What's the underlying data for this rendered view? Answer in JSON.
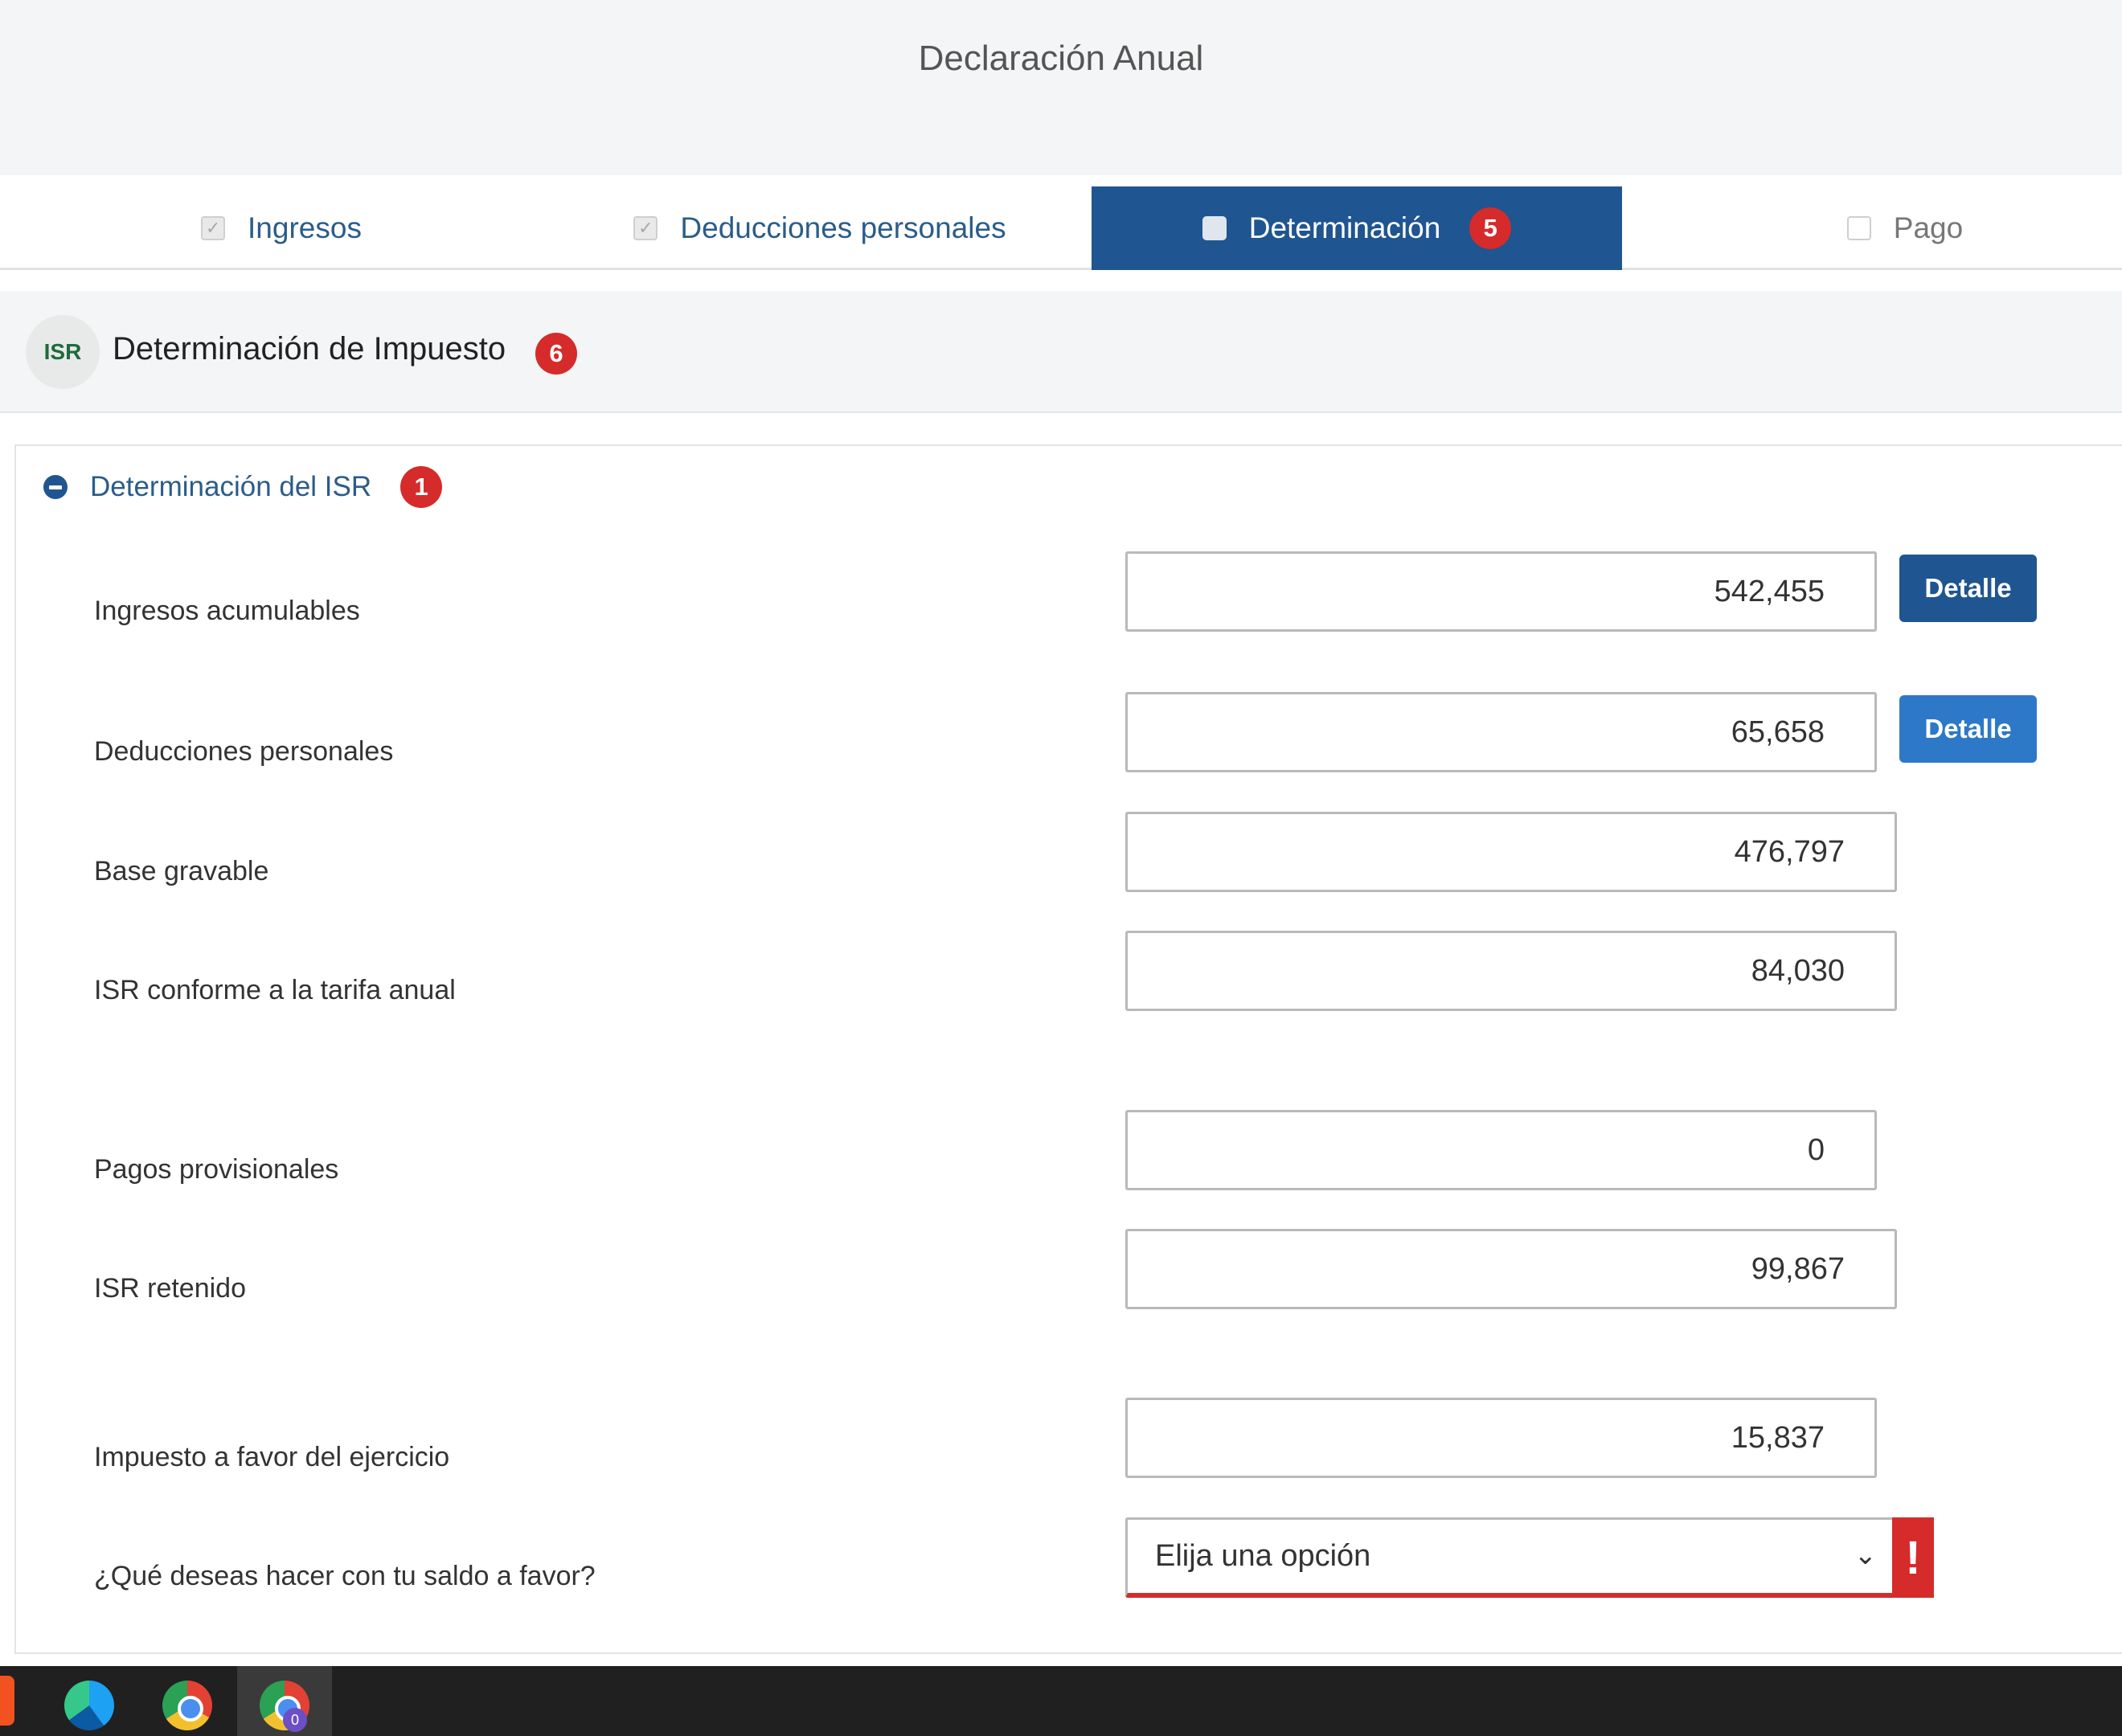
{
  "header": {
    "title": "Declaración Anual"
  },
  "tabs": [
    {
      "label": "Ingresos",
      "checked": true
    },
    {
      "label": "Deducciones personales",
      "checked": true
    },
    {
      "label": "Determinación",
      "badge": "5",
      "active": true
    },
    {
      "label": "Pago",
      "checked": false
    }
  ],
  "section": {
    "icon_text": "ISR",
    "title": "Determinación de Impuesto",
    "badge": "6"
  },
  "subsection": {
    "title": "Determinación del ISR",
    "badge": "1"
  },
  "rows": [
    {
      "label": "Ingresos acumulables",
      "value": "542,455",
      "button": "Detalle"
    },
    {
      "label": "Deducciones personales",
      "value": "65,658",
      "button": "Detalle"
    },
    {
      "label": "Base gravable",
      "value": "476,797"
    },
    {
      "label": "ISR conforme a la tarifa anual",
      "value": "84,030"
    },
    {
      "label": "Pagos provisionales",
      "value": "0"
    },
    {
      "label": "ISR retenido",
      "value": "99,867"
    },
    {
      "label": "Impuesto a favor del ejercicio",
      "value": "15,837"
    }
  ],
  "saldo_question": {
    "label": "¿Qué deseas hacer con tu saldo a favor?",
    "selected": "Elija una opción",
    "error_mark": "!"
  },
  "taskbar": {
    "chrome_profile_badge": "0"
  },
  "colors": {
    "primary": "#1f5590",
    "button_light": "#2d79c7",
    "error": "#d52b2b"
  }
}
